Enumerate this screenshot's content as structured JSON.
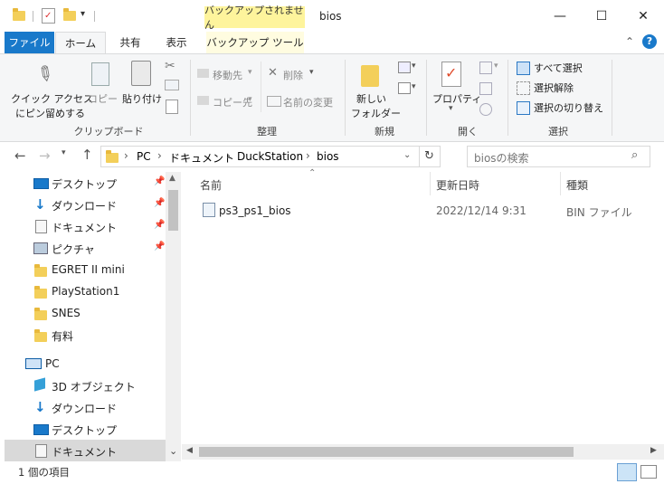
{
  "window": {
    "title": "bios",
    "context_tab_header": "バックアップされません",
    "min_glyph": "—",
    "max_glyph": "☐",
    "close_glyph": "✕"
  },
  "tabs": [
    {
      "label": "ファイル"
    },
    {
      "label": "ホーム"
    },
    {
      "label": "共有"
    },
    {
      "label": "表示"
    },
    {
      "label": "バックアップ ツール"
    }
  ],
  "ribbon": {
    "clipboard": {
      "quick_access_line1": "クイック アクセス",
      "quick_access_line2": "にピン留めする",
      "copy": "コピー",
      "paste": "貼り付け",
      "group": "クリップボード"
    },
    "organize": {
      "move_to": "移動先",
      "copy_to": "コピー先",
      "delete": "削除",
      "rename": "名前の変更",
      "group": "整理"
    },
    "new": {
      "new_folder_line1": "新しい",
      "new_folder_line2": "フォルダー",
      "group": "新規"
    },
    "open": {
      "properties": "プロパティ",
      "group": "開く"
    },
    "select": {
      "select_all": "すべて選択",
      "select_none": "選択解除",
      "invert": "選択の切り替え",
      "group": "選択"
    }
  },
  "address": {
    "crumbs": [
      "PC",
      "ドキュメント",
      "DuckStation",
      "bios"
    ],
    "search_placeholder": "biosの検索"
  },
  "nav": {
    "quick": [
      {
        "label": "デスクトップ",
        "pinned": true
      },
      {
        "label": "ダウンロード",
        "pinned": true
      },
      {
        "label": "ドキュメント",
        "pinned": true
      },
      {
        "label": "ピクチャ",
        "pinned": true
      },
      {
        "label": "EGRET II mini"
      },
      {
        "label": "PlayStation1"
      },
      {
        "label": "SNES"
      },
      {
        "label": "有料"
      }
    ],
    "pc_label": "PC",
    "pc_items": [
      {
        "label": "3D オブジェクト"
      },
      {
        "label": "ダウンロード"
      },
      {
        "label": "デスクトップ"
      },
      {
        "label": "ドキュメント"
      }
    ]
  },
  "columns": {
    "name": "名前",
    "modified": "更新日時",
    "type": "種類"
  },
  "files": [
    {
      "name": "ps3_ps1_bios",
      "modified": "2022/12/14 9:31",
      "type": "BIN ファイル"
    }
  ],
  "status": {
    "count": "1 個の項目"
  },
  "colors": {
    "file_tab": "#1979ca",
    "ribbon_bg": "#f5f6f7",
    "context_tab": "#fef49c",
    "folder": "#f3cf5a",
    "selected": "#d9d9d9"
  }
}
